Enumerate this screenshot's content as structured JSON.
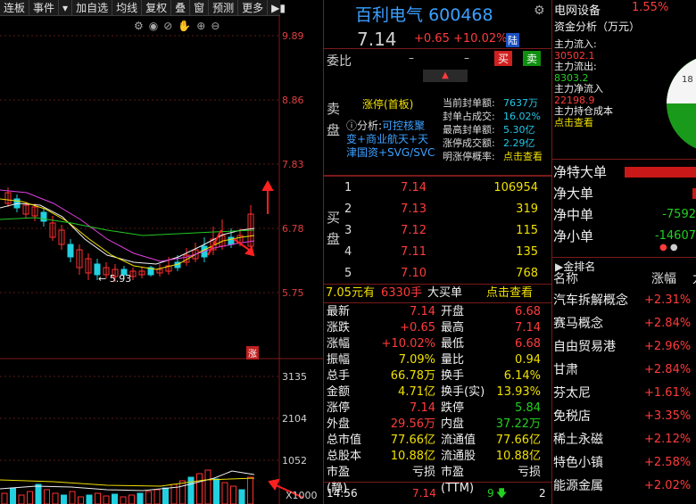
{
  "toolbar": {
    "items": [
      "连板",
      "事件",
      "▾",
      "加自选",
      "均线",
      "复权",
      "叠",
      "窗",
      "预测",
      "更多"
    ]
  },
  "stock": {
    "name": "百利电气",
    "code": "600468",
    "price": "7.14",
    "change": "+0.65",
    "pct": "+10.02%",
    "market": "陆"
  },
  "weibi": {
    "label": "委比",
    "v1": "–",
    "v2": "–",
    "buy": "买",
    "sell": "卖"
  },
  "sell_panel": {
    "side_label_1": "卖",
    "side_label_2": "盘",
    "title": "涨停(首板)",
    "analysis_label": "分析:",
    "analysis_link": "可控核聚",
    "analysis_text": "变+商业航天+天津国资+SVG/SVC",
    "seal_rows": [
      {
        "k": "当前封单额:",
        "v": "7637万"
      },
      {
        "k": "封单占成交:",
        "v": "16.02%"
      },
      {
        "k": "最高封单额:",
        "v": "5.30亿"
      },
      {
        "k": "涨停成交额:",
        "v": "2.29亿"
      },
      {
        "k": "明涨停概率:",
        "v": "点击查看"
      }
    ]
  },
  "buy_panel": {
    "side_label_1": "买",
    "side_label_2": "盘",
    "orders": [
      {
        "n": "1",
        "p": "7.14",
        "s": "106954"
      },
      {
        "n": "2",
        "p": "7.13",
        "s": "319"
      },
      {
        "n": "3",
        "p": "7.12",
        "s": "115"
      },
      {
        "n": "4",
        "p": "7.11",
        "s": "135"
      },
      {
        "n": "5",
        "p": "7.10",
        "s": "768"
      }
    ]
  },
  "big_order": {
    "price": "7.05元有",
    "vol": "6330手",
    "label": "大买单",
    "link": "点击查看"
  },
  "quote": [
    {
      "l": "最新",
      "v": "7.14",
      "vc": "red",
      "l2": "开盘",
      "v2": "6.68",
      "v2c": "red"
    },
    {
      "l": "涨跌",
      "v": "+0.65",
      "vc": "red",
      "l2": "最高",
      "v2": "7.14",
      "v2c": "red"
    },
    {
      "l": "涨幅",
      "v": "+10.02%",
      "vc": "red",
      "l2": "最低",
      "v2": "6.68",
      "v2c": "red"
    },
    {
      "l": "振幅",
      "v": "7.09%",
      "vc": "yel",
      "l2": "量比",
      "v2": "0.94",
      "v2c": "yel"
    },
    {
      "l": "总手",
      "v": "66.78万",
      "vc": "yel",
      "l2": "换手",
      "v2": "6.14%",
      "v2c": "yel"
    },
    {
      "l": "金额",
      "v": "4.71亿",
      "vc": "yel",
      "l2": "换手(实)",
      "v2": "13.93%",
      "v2c": "yel"
    },
    {
      "l": "涨停",
      "v": "7.14",
      "vc": "red",
      "l2": "跌停",
      "v2": "5.84",
      "v2c": "grn"
    },
    {
      "l": "外盘",
      "v": "29.56万",
      "vc": "red",
      "l2": "内盘",
      "v2": "37.22万",
      "v2c": "grn"
    },
    {
      "l": "总市值",
      "v": "77.66亿",
      "vc": "yel",
      "l2": "流通值",
      "v2": "77.66亿",
      "v2c": "yel"
    },
    {
      "l": "总股本",
      "v": "10.88亿",
      "vc": "yel",
      "l2": "流通股",
      "v2": "10.88亿",
      "v2c": "yel"
    },
    {
      "l": "市盈(静)",
      "v": "亏损",
      "vc": "wht",
      "l2": "市盈(TTM)",
      "v2": "亏损",
      "v2c": "wht"
    }
  ],
  "tick": {
    "time": "14:56",
    "price": "7.14",
    "vol": "9",
    "extra": "2"
  },
  "chart": {
    "yticks": [
      "9.89",
      "8.86",
      "7.83",
      "6.78",
      "5.75"
    ],
    "low_label": "5.93",
    "zhang": "涨",
    "vticks": [
      "3135",
      "2104",
      "1052",
      "X1000"
    ]
  },
  "sector": {
    "name": "电网设备",
    "pct": "1.55%"
  },
  "fund": {
    "title": "资金分析（万元）",
    "inflow_label": "主力流入:",
    "inflow": "30502.1",
    "outflow_label": "主力流出:",
    "outflow": "8303.2",
    "net_label": "主力净流入",
    "net": "22198.9",
    "cost_label": "主力持仓成本",
    "cost_link": "点击查看",
    "pie_label": "18"
  },
  "orders": [
    {
      "l": "净特大单",
      "v": ""
    },
    {
      "l": "净大单",
      "v": ""
    },
    {
      "l": "净中单",
      "v": "-7592"
    },
    {
      "l": "净小单",
      "v": "-14607"
    }
  ],
  "hot": {
    "title": "金排名",
    "col1": "名称",
    "col2": "涨幅",
    "col3": "九",
    "items": [
      {
        "n": "汽车拆解概念",
        "v": "+2.31%"
      },
      {
        "n": "赛马概念",
        "v": "+2.84%"
      },
      {
        "n": "自由贸易港",
        "v": "+2.96%"
      },
      {
        "n": "甘肃",
        "v": "+2.84%"
      },
      {
        "n": "芬太尼",
        "v": "+1.61%"
      },
      {
        "n": "免税店",
        "v": "+3.35%"
      },
      {
        "n": "稀土永磁",
        "v": "+2.12%"
      },
      {
        "n": "特色小镇",
        "v": "+2.58%"
      },
      {
        "n": "能源金属",
        "v": "+2.02%"
      }
    ]
  },
  "colors": {
    "up": "#ff3b3b",
    "down": "#22d022",
    "yellow": "#f0e000",
    "cyan": "#22c8e8",
    "bg": "#000000"
  }
}
